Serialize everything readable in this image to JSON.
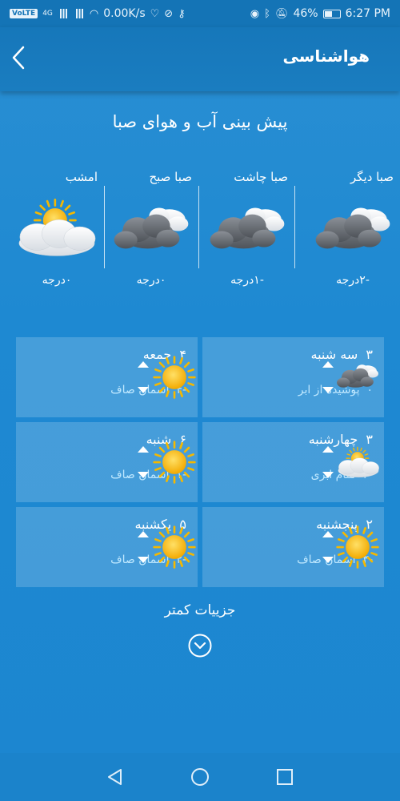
{
  "status_bar": {
    "carrier_tag": "VoLTE",
    "network": "4G",
    "speed": "0.00K/s",
    "battery": "46%",
    "time": "6:27 PM"
  },
  "app_bar": {
    "title": "هواشناسی",
    "back_icon": "chevron-left-icon"
  },
  "subtitle": "پیش بینی آب و هوای صبا",
  "forecast_strip": [
    {
      "label": "صبا دیگر",
      "temp": "-۲درجه",
      "icon": "cloudy-icon"
    },
    {
      "label": "صبا چاشت",
      "temp": "-۱درجه",
      "icon": "cloudy-icon"
    },
    {
      "label": "صبا صبح",
      "temp": "۰درجه",
      "icon": "cloudy-icon"
    },
    {
      "label": "امشب",
      "temp": "۰درجه",
      "icon": "partly-cloudy-icon"
    }
  ],
  "daily": [
    {
      "day": "سه شنبه",
      "high": "۳",
      "low": "۰",
      "condition": "پوشیده از ابر",
      "icon": "cloudy-icon"
    },
    {
      "day": "جمعه",
      "high": "۴",
      "low": "-۴",
      "condition": "آسمان صاف",
      "icon": "sun-icon"
    },
    {
      "day": "چهارشنبه",
      "high": "۳",
      "low": "-۲",
      "condition": "تمام ابری",
      "icon": "partly-cloudy-icon"
    },
    {
      "day": "شنبه",
      "high": "۶",
      "low": "-۱",
      "condition": "آسمان صاف",
      "icon": "sun-icon"
    },
    {
      "day": "پنجشنبه",
      "high": "۲",
      "low": "-۳",
      "condition": "آسمان صاف",
      "icon": "sun-icon"
    },
    {
      "day": "یکشنبه",
      "high": "۵",
      "low": "-۲",
      "condition": "آسمان صاف",
      "icon": "sun-icon"
    }
  ],
  "less_details_label": "جزییات کمتر",
  "nav": {
    "back_icon": "nav-back-icon",
    "home_icon": "nav-home-icon",
    "recents_icon": "nav-recents-icon"
  },
  "colors": {
    "background": "#1e89d2",
    "app_bar": "#1677ba",
    "card": "rgba(255,255,255,0.18)",
    "condition_text": "#bfe8ff",
    "sun": "#f5b800"
  }
}
